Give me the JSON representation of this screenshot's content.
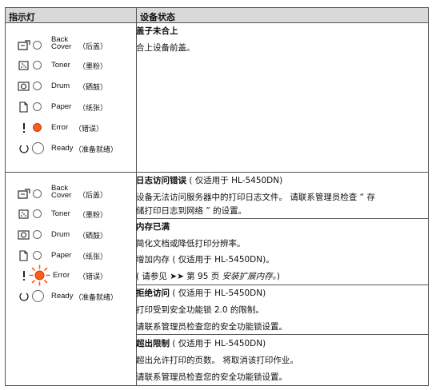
{
  "header": {
    "col1": "指示灯",
    "col2": "设备状态"
  },
  "indicators": {
    "back_cover": "Back\nCover",
    "back_cover_cn": "（后盖）",
    "toner": "Toner",
    "toner_cn": "（墨粉）",
    "drum": "Drum",
    "drum_cn": "（硒鼓）",
    "paper": "Paper",
    "paper_cn": "（纸张）",
    "error": "Error",
    "error_cn": "（错误）",
    "ready": "Ready",
    "ready_cn": "（准备就绪）"
  },
  "section1": {
    "title": "盖子未合上",
    "desc": "合上设备前盖。"
  },
  "section2": {
    "title": "日志访问错误",
    "title_suffix": " ( 仅适用于 HL-5450DN)",
    "desc_line1": "设备无法访问服务器中的打印日志文件。 请联系管理员检查 “ 存",
    "desc_line2": "储打印日志到网络 ” 的设置。"
  },
  "section3": {
    "title": "内存已满",
    "line1": "简化文档或降低打印分辨率。",
    "line2": "增加内存 ( 仅适用于 HL-5450DN)。",
    "line3_pre": "( 请参见 ➤➤ 第 95 页 ",
    "line3_italic": "安装扩展内存。",
    "line3_post": ")"
  },
  "section4": {
    "title": "拒绝访问",
    "title_suffix": " ( 仅适用于 HL-5450DN)",
    "line1": "打印受到安全功能锁 2.0 的限制。",
    "line2": "请联系管理员检查您的安全功能锁设置。"
  },
  "section5": {
    "title": "超出限制",
    "title_suffix": " ( 仅适用于 HL-5450DN)",
    "line1": "超出允许打印的页数。 将取消该打印作业。",
    "line2": "请联系管理员检查您的安全功能锁设置。"
  }
}
